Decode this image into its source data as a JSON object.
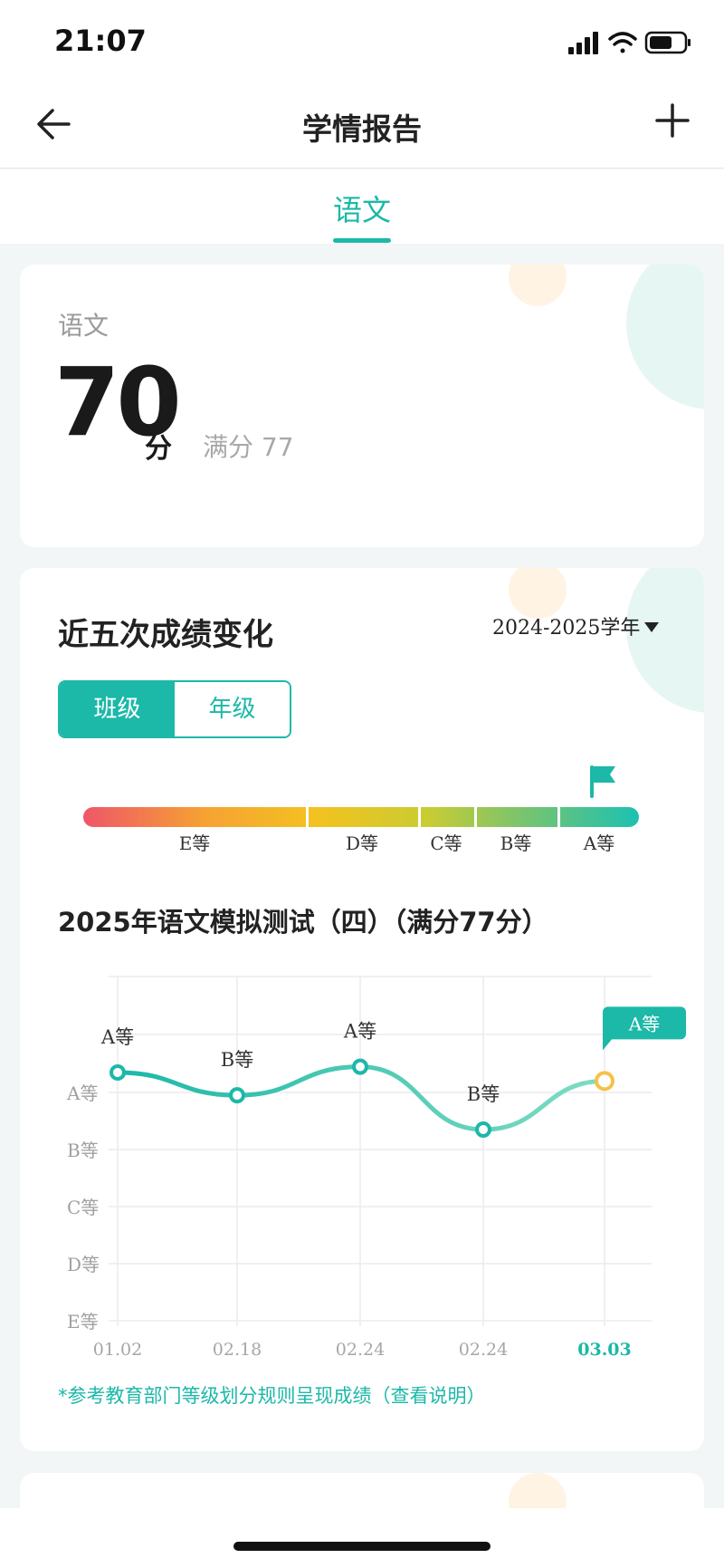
{
  "status": {
    "time": "21:07"
  },
  "nav": {
    "title": "学情报告"
  },
  "tabs": [
    {
      "label": "语文",
      "active": true
    }
  ],
  "score_card": {
    "subject": "语文",
    "score": "70",
    "unit": "分",
    "full_score": "满分 77"
  },
  "trend_card": {
    "title": "近五次成绩变化",
    "year": "2024-2025学年",
    "segments": [
      {
        "label": "班级",
        "active": true
      },
      {
        "label": "年级",
        "active": false
      }
    ],
    "levels": [
      "E等",
      "D等",
      "C等",
      "B等",
      "A等"
    ],
    "current_level": "A等",
    "exam_title": "2025年语文模拟测试（四）（满分77分）",
    "note": "*参考教育部门等级划分规则呈现成绩（查看说明）"
  },
  "colors": {
    "accent": "#1cb8a8",
    "highlight_point": "#f3c24a"
  },
  "chart_data": {
    "type": "line",
    "x": [
      "01.02",
      "02.18",
      "02.24",
      "02.24",
      "03.03"
    ],
    "y_levels": [
      "E等",
      "D等",
      "C等",
      "B等",
      "A等"
    ],
    "point_labels": [
      "A等",
      "B等",
      "A等",
      "B等",
      "A等"
    ],
    "values": [
      4.35,
      3.95,
      4.45,
      3.35,
      4.2
    ],
    "highlight_index": 4
  }
}
